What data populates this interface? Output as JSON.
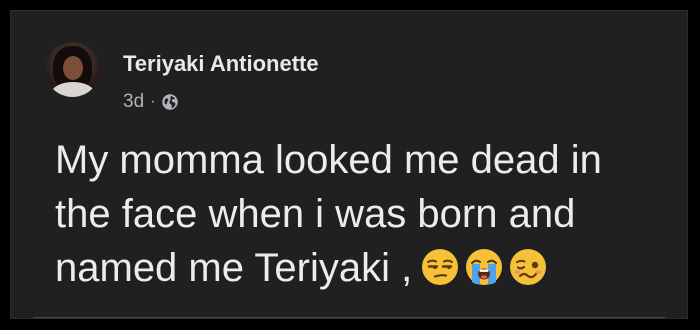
{
  "post": {
    "author_name": "Teriyaki Antionette",
    "timestamp": "3d",
    "separator": "·",
    "audience_icon": "globe-icon",
    "text_lines": [
      "My momma looked me dead in",
      "the face when i was born and",
      "named me Teriyaki ,"
    ],
    "emojis": [
      "unamused-face",
      "loudly-crying-face",
      "woozy-face"
    ]
  },
  "colors": {
    "background": "#000000",
    "card": "#202020",
    "text_primary": "#ececec",
    "text_secondary": "#b0b3b8",
    "emoji_yellow": "#f6c136"
  }
}
